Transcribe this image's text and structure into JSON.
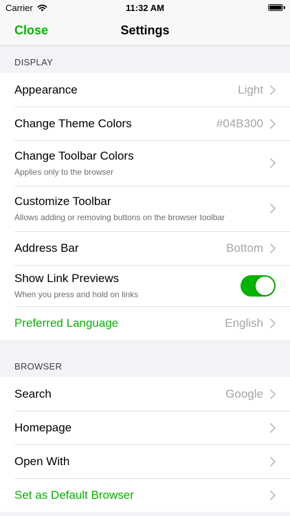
{
  "status_bar": {
    "carrier": "Carrier",
    "time": "11:32 AM"
  },
  "nav": {
    "close_label": "Close",
    "title": "Settings"
  },
  "colors": {
    "accent": "#04B300",
    "secondary_text": "#A5A5AA"
  },
  "display_section": {
    "header": "DISPLAY",
    "rows": [
      {
        "label": "Appearance",
        "value": "Light"
      },
      {
        "label": "Change Theme Colors",
        "value": "#04B300"
      },
      {
        "label": "Change Toolbar Colors",
        "subtitle": "Applies only to the browser"
      },
      {
        "label": "Customize Toolbar",
        "subtitle": "Allows adding or removing buttons on the browser toolbar"
      },
      {
        "label": "Address Bar",
        "value": "Bottom"
      },
      {
        "label": "Show Link Previews",
        "subtitle": "When you press and hold on links",
        "toggle": true
      },
      {
        "label": "Preferred Language",
        "value": "English"
      }
    ]
  },
  "browser_section": {
    "header": "BROWSER",
    "rows": [
      {
        "label": "Search",
        "value": "Google"
      },
      {
        "label": "Homepage"
      },
      {
        "label": "Open With"
      },
      {
        "label": "Set as Default Browser"
      }
    ]
  }
}
